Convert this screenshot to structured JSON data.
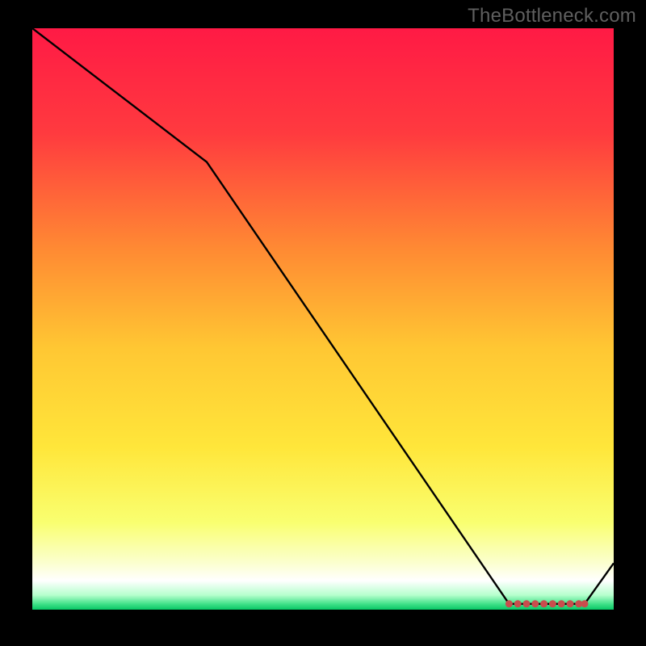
{
  "watermark": "TheBottleneck.com",
  "chart_data": {
    "type": "line",
    "title": "",
    "xlabel": "",
    "ylabel": "",
    "xlim": [
      0,
      100
    ],
    "ylim": [
      0,
      100
    ],
    "series": [
      {
        "name": "curve",
        "x": [
          0,
          30,
          82,
          88,
          95,
          100
        ],
        "values": [
          100,
          77,
          1,
          1,
          1,
          8
        ]
      }
    ],
    "marker_band": {
      "name": "flat-segment-markers",
      "x": [
        82,
        83.5,
        85,
        86.5,
        88,
        89.5,
        91,
        92.5,
        94,
        95
      ],
      "values": [
        1,
        1,
        1,
        1,
        1,
        1,
        1,
        1,
        1,
        1
      ]
    },
    "gradient_stops": [
      {
        "pos": 0.0,
        "color": "#ff1a45"
      },
      {
        "pos": 0.18,
        "color": "#ff3a3f"
      },
      {
        "pos": 0.38,
        "color": "#ff8a33"
      },
      {
        "pos": 0.55,
        "color": "#ffc733"
      },
      {
        "pos": 0.72,
        "color": "#ffe63a"
      },
      {
        "pos": 0.85,
        "color": "#f9ff70"
      },
      {
        "pos": 0.92,
        "color": "#fbffcf"
      },
      {
        "pos": 0.95,
        "color": "#ffffff"
      },
      {
        "pos": 0.975,
        "color": "#b6ffcd"
      },
      {
        "pos": 0.99,
        "color": "#42e28a"
      },
      {
        "pos": 1.0,
        "color": "#07c765"
      }
    ],
    "marker_color": "#c94d4d",
    "line_color": "#000000"
  }
}
